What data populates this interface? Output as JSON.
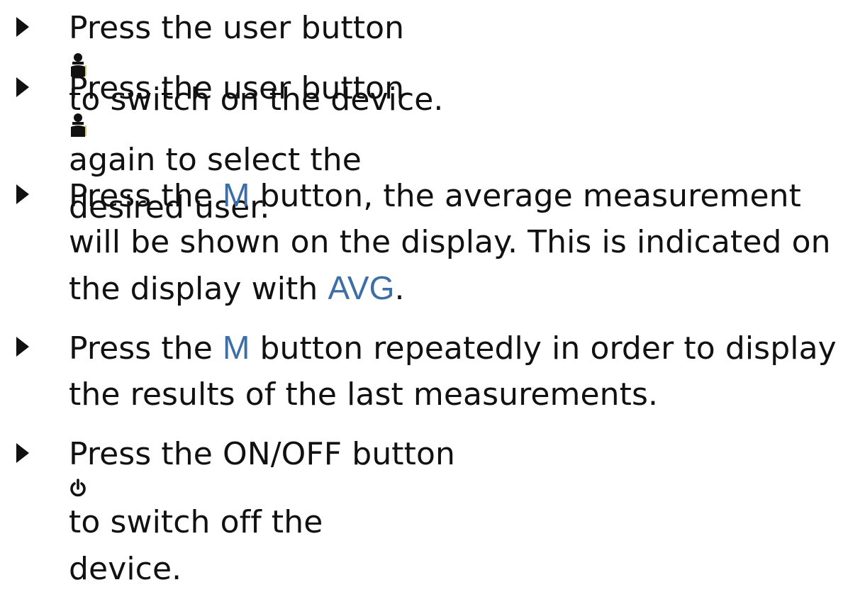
{
  "colors": {
    "text": "#111111",
    "accent": "#3d6ea8",
    "bullet": "#111111"
  },
  "steps": [
    {
      "parts": {
        "a": "Press the user button ",
        "icon": "user-icon",
        "b": " to switch on the device."
      }
    },
    {
      "parts": {
        "a": "Press the user button ",
        "icon": "user-icon",
        "b": " again to select the",
        "c": "desired user."
      }
    },
    {
      "parts": {
        "a": "Press the ",
        "m": "M",
        "b": " button, the average measurement",
        "c": "will be shown on the display. This is indicated on",
        "d": "the display with ",
        "avg": "AVG",
        "e": "."
      }
    },
    {
      "parts": {
        "a": "Press the ",
        "m": "M",
        "b": " button repeatedly in order to display",
        "c": "the results of the last measurements."
      }
    },
    {
      "parts": {
        "a": "Press the ON/OFF button ",
        "icon": "power-icon",
        "b": " to switch off the",
        "c": "device."
      }
    }
  ]
}
